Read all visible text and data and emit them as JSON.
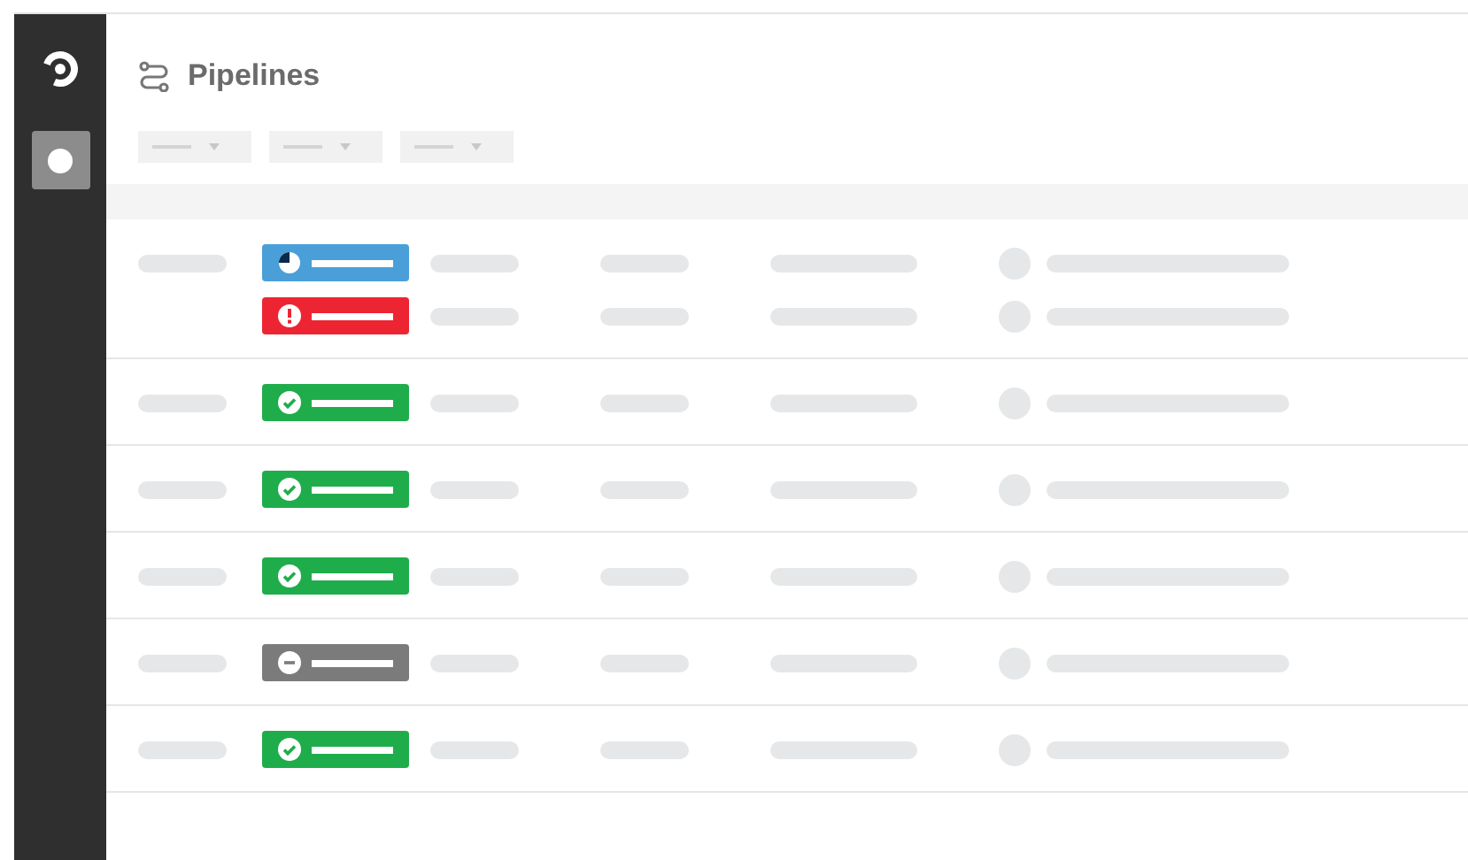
{
  "header": {
    "title": "Pipelines"
  },
  "filters": [
    {
      "kind": "dropdown"
    },
    {
      "kind": "dropdown"
    },
    {
      "kind": "dropdown"
    }
  ],
  "pipelines": [
    {
      "workflows": [
        {
          "kind": "running"
        },
        {
          "kind": "failed"
        }
      ]
    },
    {
      "workflows": [
        {
          "kind": "success"
        }
      ]
    },
    {
      "workflows": [
        {
          "kind": "success"
        }
      ]
    },
    {
      "workflows": [
        {
          "kind": "success"
        }
      ]
    },
    {
      "workflows": [
        {
          "kind": "canceled"
        }
      ]
    },
    {
      "workflows": [
        {
          "kind": "success"
        }
      ]
    }
  ]
}
